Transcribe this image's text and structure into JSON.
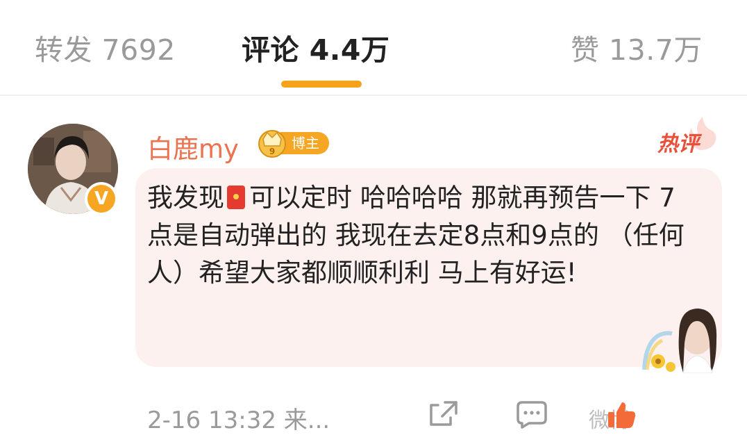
{
  "tabs": {
    "repost": "转发 7692",
    "comments": "评论 4.4万",
    "likes": "赞 13.7万",
    "active_color": "#f7a21b"
  },
  "comment": {
    "username": "白鹿my",
    "role_badge": "博主",
    "crown_level": "9",
    "verified_mark": "V",
    "hot_tag": "热评",
    "text_part1": "我发现",
    "text_part2": "可以定时 哈哈哈哈 那就再预告一下 7点是自动弹出的 我现在去定8点和9点的 （任何人）希望大家都顺顺利利 马上有好运!",
    "username_color": "#eb7350",
    "bubble_color": "#fdf1ef",
    "icons": {
      "redpacket": "red-packet-icon",
      "crown": "crown-icon",
      "verified": "verified-v-icon"
    }
  },
  "footer": {
    "timestamp": "2-16 13:32 来...",
    "watermark": "微博",
    "icons": {
      "share": "share-icon",
      "comment": "comment-icon",
      "like": "like-icon"
    }
  }
}
